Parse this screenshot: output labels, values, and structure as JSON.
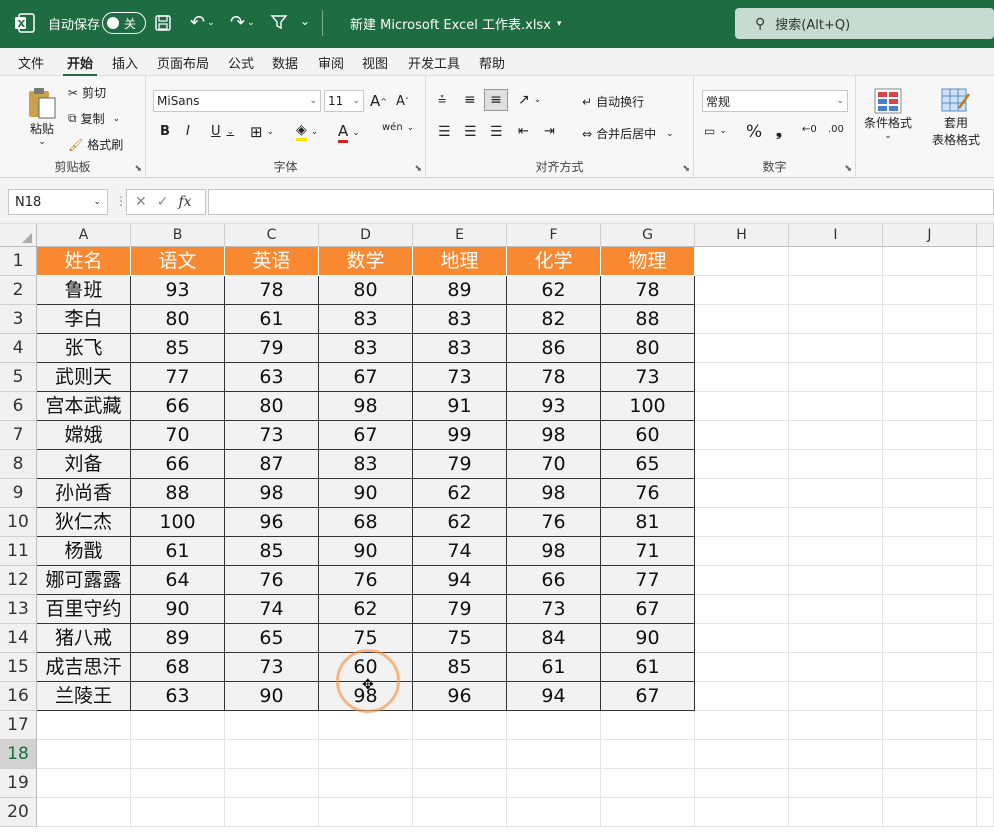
{
  "titlebar": {
    "autosave_label": "自动保存",
    "autosave_state": "关",
    "filename": "新建 Microsoft Excel 工作表.xlsx",
    "search_placeholder": "搜索(Alt+Q)"
  },
  "tabs": [
    "文件",
    "开始",
    "插入",
    "页面布局",
    "公式",
    "数据",
    "审阅",
    "视图",
    "开发工具",
    "帮助"
  ],
  "ribbon": {
    "clipboard": {
      "paste": "粘贴",
      "cut": "剪切",
      "copy": "复制",
      "format_painter": "格式刷",
      "label": "剪贴板"
    },
    "font": {
      "name": "MiSans",
      "size": "11",
      "bold": "B",
      "italic": "I",
      "underline": "U",
      "label": "字体",
      "wen": "wén"
    },
    "align": {
      "wrap": "自动换行",
      "merge": "合并后居中",
      "label": "对齐方式"
    },
    "number": {
      "format": "常规",
      "percent": "%",
      "comma": "❟",
      "label": "数字"
    },
    "styles": {
      "cond": "条件格式",
      "table1": "套用",
      "table2": "表格格式"
    }
  },
  "namebox": "N18",
  "fx": "fx",
  "columns": [
    "A",
    "B",
    "C",
    "D",
    "E",
    "F",
    "G",
    "H",
    "I",
    "J"
  ],
  "rows": [
    "1",
    "2",
    "3",
    "4",
    "5",
    "6",
    "7",
    "8",
    "9",
    "10",
    "11",
    "12",
    "13",
    "14",
    "15",
    "16",
    "17",
    "18",
    "19",
    "20"
  ],
  "table": {
    "headers": [
      "姓名",
      "语文",
      "英语",
      "数学",
      "地理",
      "化学",
      "物理"
    ],
    "data": [
      [
        "鲁班",
        "93",
        "78",
        "80",
        "89",
        "62",
        "78"
      ],
      [
        "李白",
        "80",
        "61",
        "83",
        "83",
        "82",
        "88"
      ],
      [
        "张飞",
        "85",
        "79",
        "83",
        "83",
        "86",
        "80"
      ],
      [
        "武则天",
        "77",
        "63",
        "67",
        "73",
        "78",
        "73"
      ],
      [
        "宫本武藏",
        "66",
        "80",
        "98",
        "91",
        "93",
        "100"
      ],
      [
        "嫦娥",
        "70",
        "73",
        "67",
        "99",
        "98",
        "60"
      ],
      [
        "刘备",
        "66",
        "87",
        "83",
        "79",
        "70",
        "65"
      ],
      [
        "孙尚香",
        "88",
        "98",
        "90",
        "62",
        "98",
        "76"
      ],
      [
        "狄仁杰",
        "100",
        "96",
        "68",
        "62",
        "76",
        "81"
      ],
      [
        "杨戬",
        "61",
        "85",
        "90",
        "74",
        "98",
        "71"
      ],
      [
        "娜可露露",
        "64",
        "76",
        "76",
        "94",
        "66",
        "77"
      ],
      [
        "百里守约",
        "90",
        "74",
        "62",
        "79",
        "73",
        "67"
      ],
      [
        "猪八戒",
        "89",
        "65",
        "75",
        "75",
        "84",
        "90"
      ],
      [
        "成吉思汗",
        "68",
        "73",
        "60",
        "85",
        "61",
        "61"
      ],
      [
        "兰陵王",
        "63",
        "90",
        "98",
        "96",
        "94",
        "67"
      ]
    ]
  },
  "colors": {
    "header_fill": "#f98930",
    "brand": "#1e6c41"
  }
}
